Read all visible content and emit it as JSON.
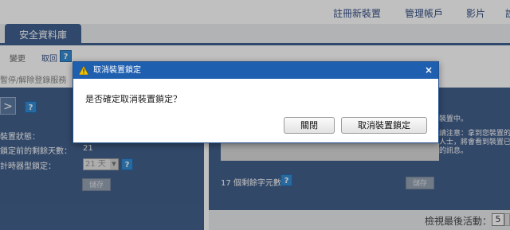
{
  "topnav": {
    "items": [
      "註冊新裝置",
      "管理帳戶",
      "影片",
      "說"
    ]
  },
  "tab": {
    "label": "安全資料庫"
  },
  "subbar": {
    "link1": "變更",
    "link2": "取回",
    "help": "?"
  },
  "breadcrumb": "暫停/解除登錄服務",
  "left_panel": {
    "arrow": ">",
    "help": "?",
    "status_label": "裝置狀態：",
    "days_label": "鎖定前的剩餘天數：",
    "days_value": "21",
    "timer_label": "計時器型鎖定：",
    "timer_select": "21 天",
    "timer_help": "?",
    "save_button": "儲存"
  },
  "right_panel": {
    "line1": "裝置中。",
    "line2": "請注意：拿到您裝置的",
    "line3": "人士，將會看到裝置已",
    "line4": "的訊息。",
    "remaining": "17 個剩餘字元數",
    "help": "?",
    "save_button": "儲存"
  },
  "activity": {
    "label": "檢視最後活動：",
    "value": "5"
  },
  "dialog": {
    "title": "取消裝置鎖定",
    "close": "×",
    "message": "是否確定取消裝置鎖定？",
    "close_button": "關閉",
    "confirm_button": "取消裝置鎖定"
  },
  "colors": {
    "nav_blue": "#2b4f84",
    "panel_blue": "#2f4f7f",
    "dialog_title": "#1f5fb0",
    "help_blue": "#1f7fcf",
    "warning_yellow": "#f4c800"
  },
  "icons": {
    "warning": "warning-icon",
    "help": "help-icon",
    "close": "close-icon"
  }
}
